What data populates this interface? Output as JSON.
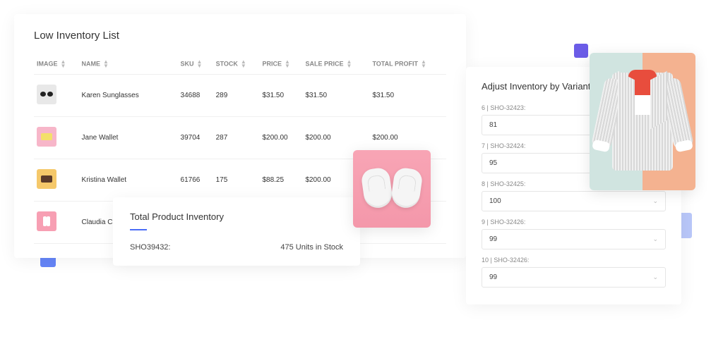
{
  "inventory": {
    "title": "Low Inventory List",
    "columns": [
      "IMAGE",
      "NAME",
      "SKU",
      "STOCK",
      "PRICE",
      "SALE PRICE",
      "TOTAL PROFIT"
    ],
    "rows": [
      {
        "name": "Karen Sunglasses",
        "sku": "34688",
        "stock": "289",
        "price": "$31.50",
        "sale": "$31.50",
        "profit": "$31.50"
      },
      {
        "name": "Jane Wallet",
        "sku": "39704",
        "stock": "287",
        "price": "$200.00",
        "sale": "$200.00",
        "profit": "$200.00"
      },
      {
        "name": "Kristina Wallet",
        "sku": "61766",
        "stock": "175",
        "price": "$88.25",
        "sale": "$200.00",
        "profit": ""
      },
      {
        "name": "Claudia Clutch",
        "sku": "",
        "stock": "",
        "price": "",
        "sale": "",
        "profit": ""
      }
    ]
  },
  "total": {
    "title": "Total Product Inventory",
    "sku_label": "SHO39432:",
    "stock_text": "475 Units in Stock"
  },
  "adjust": {
    "title": "Adjust Inventory by  Variant",
    "variants": [
      {
        "label": "6 | SHO-32423:",
        "value": "81",
        "hasChevron": false
      },
      {
        "label": "7 | SHO-32424:",
        "value": "95",
        "hasChevron": false
      },
      {
        "label": "8 | SHO-32425:",
        "value": "100",
        "hasChevron": true
      },
      {
        "label": "9 | SHO-32426:",
        "value": "99",
        "hasChevron": true
      },
      {
        "label": "10 | SHO-32426:",
        "value": "99",
        "hasChevron": true
      }
    ]
  }
}
